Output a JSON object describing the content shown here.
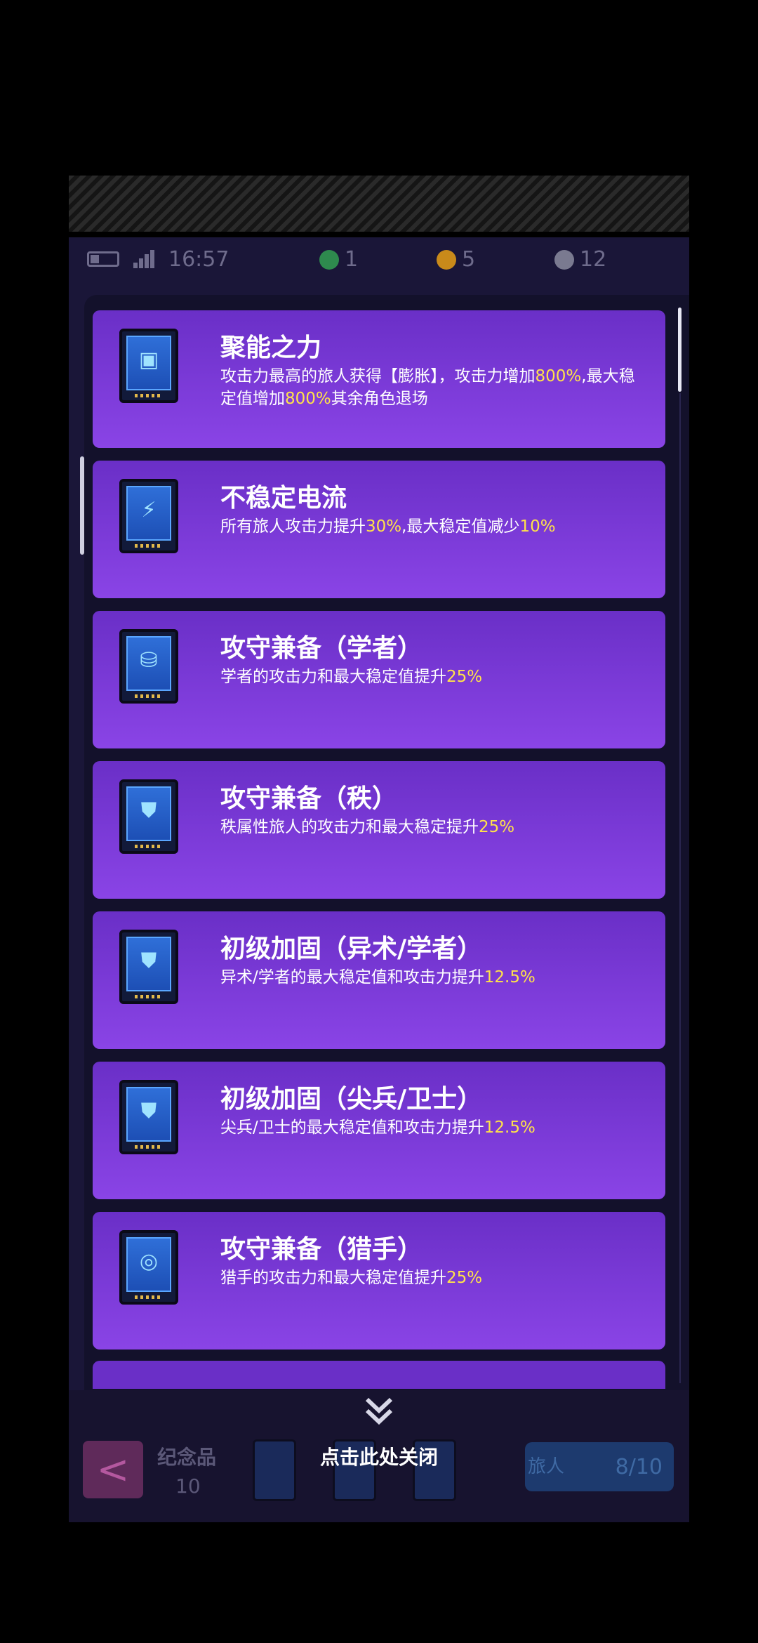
{
  "status": {
    "time": "16:57",
    "currencies": [
      {
        "name": "green-gem",
        "value": "1",
        "color": "#2e8a4e"
      },
      {
        "name": "gold-coin",
        "value": "5",
        "color": "#c98a1a"
      },
      {
        "name": "silver-coin",
        "value": "12",
        "color": "#7a7a90"
      }
    ]
  },
  "cards": [
    {
      "title": "聚能之力",
      "icon": "cube-icon",
      "desc": [
        {
          "t": "攻击力最高的旅人获得【膨胀】，攻击力增加"
        },
        {
          "t": "800%",
          "hl": true
        },
        {
          "t": ",最大稳定值增加"
        },
        {
          "t": "800%",
          "hl": true
        },
        {
          "t": "其余角色退场"
        }
      ]
    },
    {
      "title": "不稳定电流",
      "icon": "lightning-icon",
      "desc": [
        {
          "t": "所有旅人攻击力提升"
        },
        {
          "t": "30%",
          "hl": true
        },
        {
          "t": ",最大稳定值减少"
        },
        {
          "t": "10%",
          "hl": true
        }
      ]
    },
    {
      "title": "攻守兼备（学者）",
      "icon": "cylinder-icon",
      "desc": [
        {
          "t": "学者的攻击力和最大稳定值提升"
        },
        {
          "t": "25%",
          "hl": true
        }
      ]
    },
    {
      "title": "攻守兼备（秩）",
      "icon": "shield-icon",
      "desc": [
        {
          "t": "秩属性旅人的攻击力和最大稳定提升"
        },
        {
          "t": "25%",
          "hl": true
        }
      ]
    },
    {
      "title": "初级加固（异术/学者）",
      "icon": "shield-icon",
      "desc": [
        {
          "t": "异术/学者的最大稳定值和攻击力提升"
        },
        {
          "t": "12.5%",
          "hl": true
        }
      ]
    },
    {
      "title": "初级加固（尖兵/卫士）",
      "icon": "shield-icon",
      "desc": [
        {
          "t": "尖兵/卫士的最大稳定值和攻击力提升"
        },
        {
          "t": "12.5%",
          "hl": true
        }
      ]
    },
    {
      "title": "攻守兼备（猎手）",
      "icon": "target-icon",
      "desc": [
        {
          "t": "猎手的攻击力和最大稳定值提升"
        },
        {
          "t": "25%",
          "hl": true
        }
      ]
    }
  ],
  "bottom": {
    "back_glyph": "<",
    "souvenir_label": "纪念品",
    "souvenir_count": "10",
    "traveler_label": "旅人",
    "traveler_count": "8/10"
  },
  "close_text": "点击此处关闭"
}
